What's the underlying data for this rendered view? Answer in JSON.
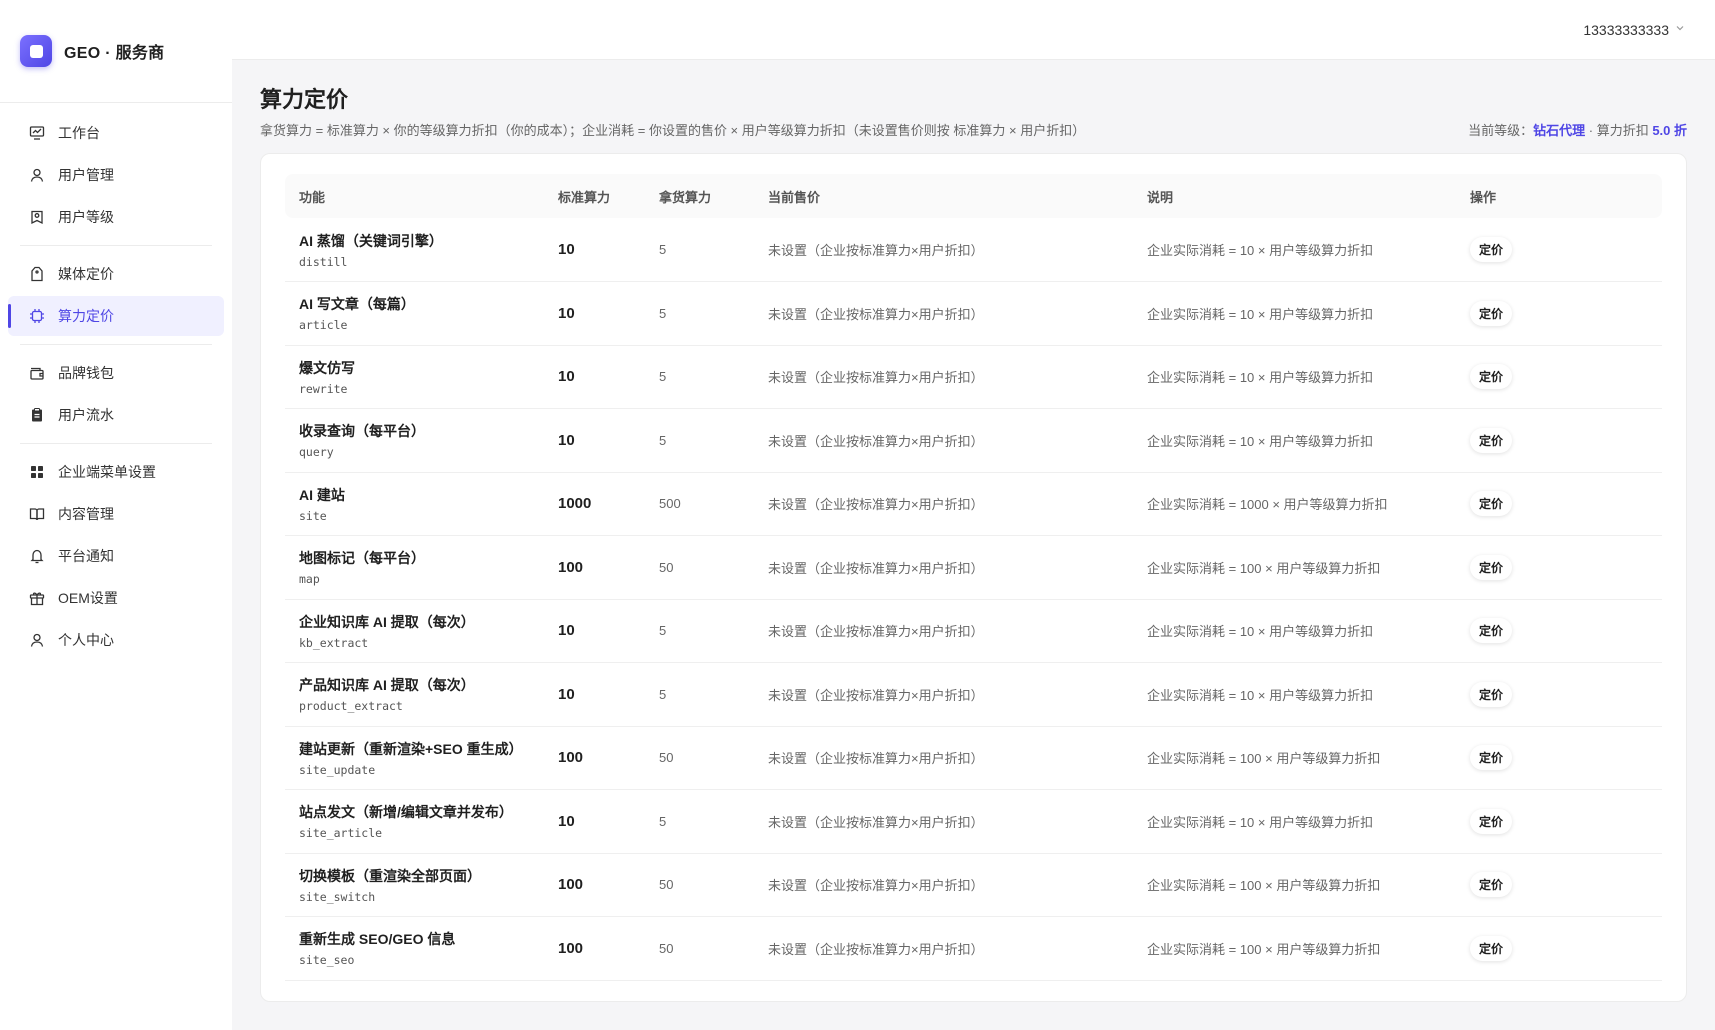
{
  "brand": {
    "name": "GEO · 服务商"
  },
  "topbar": {
    "user": "13333333333"
  },
  "sidebar": {
    "groups": [
      [
        {
          "label": "工作台",
          "icon": "dashboard-icon"
        },
        {
          "label": "用户管理",
          "icon": "user-icon"
        },
        {
          "label": "用户等级",
          "icon": "badge-icon"
        }
      ],
      [
        {
          "label": "媒体定价",
          "icon": "price-tag-icon"
        },
        {
          "label": "算力定价",
          "icon": "chip-icon",
          "active": true
        }
      ],
      [
        {
          "label": "品牌钱包",
          "icon": "wallet-icon"
        },
        {
          "label": "用户流水",
          "icon": "clipboard-icon"
        }
      ],
      [
        {
          "label": "企业端菜单设置",
          "icon": "grid-icon"
        },
        {
          "label": "内容管理",
          "icon": "book-icon"
        },
        {
          "label": "平台通知",
          "icon": "bell-icon"
        },
        {
          "label": "OEM设置",
          "icon": "gift-icon"
        },
        {
          "label": "个人中心",
          "icon": "person-icon"
        }
      ]
    ]
  },
  "page": {
    "title": "算力定价",
    "formula": "拿货算力 = 标准算力 × 你的等级算力折扣（你的成本）；企业消耗 = 你设置的售价 × 用户等级算力折扣（未设置售价则按 标准算力 × 用户折扣）",
    "level_prefix": "当前等级：",
    "level_name": "钻石代理",
    "discount_prefix": " · 算力折扣 ",
    "discount_value": "5.0 折"
  },
  "table": {
    "headers": {
      "fn": "功能",
      "std": "标准算力",
      "cost": "拿货算力",
      "price": "当前售价",
      "desc": "说明",
      "op": "操作"
    },
    "rows": [
      {
        "name": "AI 蒸馏（关键词引擎）",
        "key": "distill",
        "std": "10",
        "cost": "5",
        "price": "未设置（企业按标准算力×用户折扣）",
        "desc": "企业实际消耗 = 10 × 用户等级算力折扣",
        "action": "定价"
      },
      {
        "name": "AI 写文章（每篇）",
        "key": "article",
        "std": "10",
        "cost": "5",
        "price": "未设置（企业按标准算力×用户折扣）",
        "desc": "企业实际消耗 = 10 × 用户等级算力折扣",
        "action": "定价"
      },
      {
        "name": "爆文仿写",
        "key": "rewrite",
        "std": "10",
        "cost": "5",
        "price": "未设置（企业按标准算力×用户折扣）",
        "desc": "企业实际消耗 = 10 × 用户等级算力折扣",
        "action": "定价"
      },
      {
        "name": "收录查询（每平台）",
        "key": "query",
        "std": "10",
        "cost": "5",
        "price": "未设置（企业按标准算力×用户折扣）",
        "desc": "企业实际消耗 = 10 × 用户等级算力折扣",
        "action": "定价"
      },
      {
        "name": "AI 建站",
        "key": "site",
        "std": "1000",
        "cost": "500",
        "price": "未设置（企业按标准算力×用户折扣）",
        "desc": "企业实际消耗 = 1000 × 用户等级算力折扣",
        "action": "定价"
      },
      {
        "name": "地图标记（每平台）",
        "key": "map",
        "std": "100",
        "cost": "50",
        "price": "未设置（企业按标准算力×用户折扣）",
        "desc": "企业实际消耗 = 100 × 用户等级算力折扣",
        "action": "定价"
      },
      {
        "name": "企业知识库 AI 提取（每次）",
        "key": "kb_extract",
        "std": "10",
        "cost": "5",
        "price": "未设置（企业按标准算力×用户折扣）",
        "desc": "企业实际消耗 = 10 × 用户等级算力折扣",
        "action": "定价"
      },
      {
        "name": "产品知识库 AI 提取（每次）",
        "key": "product_extract",
        "std": "10",
        "cost": "5",
        "price": "未设置（企业按标准算力×用户折扣）",
        "desc": "企业实际消耗 = 10 × 用户等级算力折扣",
        "action": "定价"
      },
      {
        "name": "建站更新（重新渲染+SEO 重生成）",
        "key": "site_update",
        "std": "100",
        "cost": "50",
        "price": "未设置（企业按标准算力×用户折扣）",
        "desc": "企业实际消耗 = 100 × 用户等级算力折扣",
        "action": "定价"
      },
      {
        "name": "站点发文（新增/编辑文章并发布）",
        "key": "site_article",
        "std": "10",
        "cost": "5",
        "price": "未设置（企业按标准算力×用户折扣）",
        "desc": "企业实际消耗 = 10 × 用户等级算力折扣",
        "action": "定价"
      },
      {
        "name": "切换模板（重渲染全部页面）",
        "key": "site_switch",
        "std": "100",
        "cost": "50",
        "price": "未设置（企业按标准算力×用户折扣）",
        "desc": "企业实际消耗 = 100 × 用户等级算力折扣",
        "action": "定价"
      },
      {
        "name": "重新生成 SEO/GEO 信息",
        "key": "site_seo",
        "std": "100",
        "cost": "50",
        "price": "未设置（企业按标准算力×用户折扣）",
        "desc": "企业实际消耗 = 100 × 用户等级算力折扣",
        "action": "定价"
      }
    ]
  }
}
